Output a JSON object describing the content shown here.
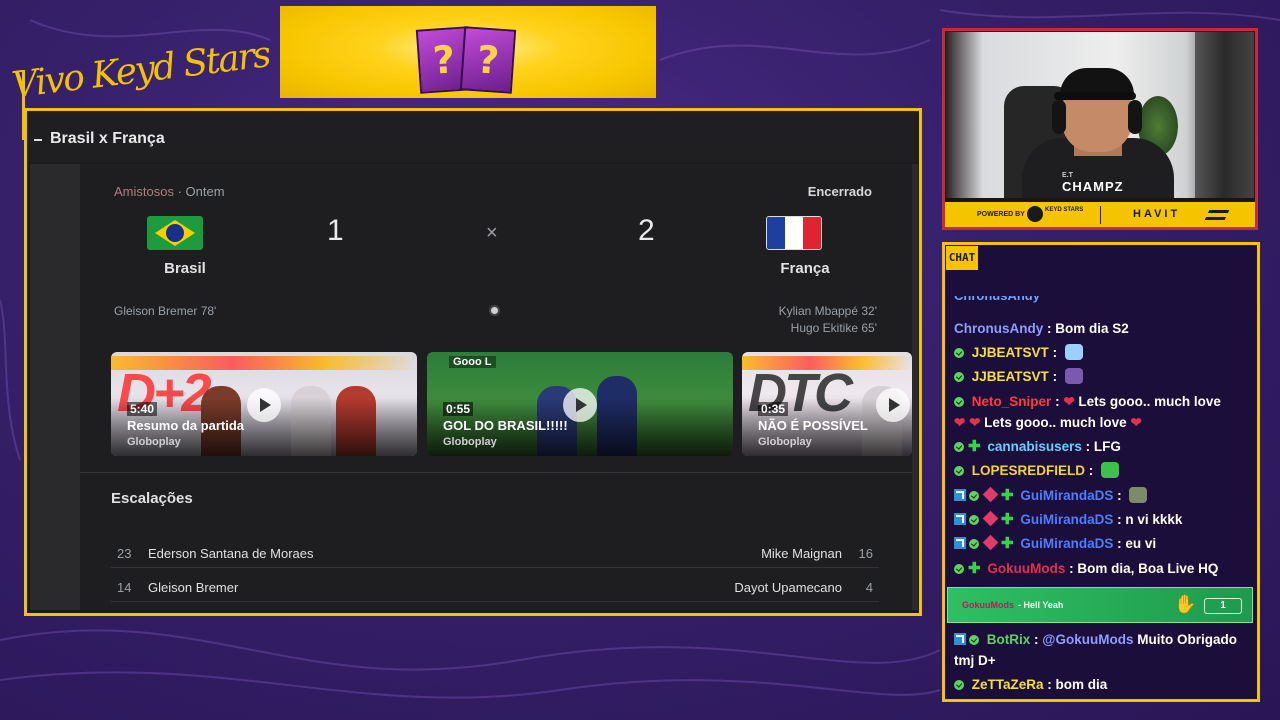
{
  "brand": {
    "text": "Vivo Keyd Stars"
  },
  "banner": {
    "box1": "?",
    "box2": "?"
  },
  "panel": {
    "title": "Brasil x França"
  },
  "match": {
    "competition": "Amistosos",
    "when": "· Ontem",
    "status": "Encerrado",
    "home": {
      "name": "Brasil",
      "score": "1",
      "scorers": [
        "Gleison Bremer 78'"
      ]
    },
    "away": {
      "name": "França",
      "score": "2",
      "scorers": [
        "Kylian Mbappé 32'",
        "Hugo Ekitike 65'"
      ]
    },
    "separator": "×"
  },
  "videos": [
    {
      "duration": "5:40",
      "title": "Resumo da partida",
      "source": "Globoplay"
    },
    {
      "duration": "0:55",
      "title": "GOL DO BRASIL!!!!!",
      "source": "Globoplay",
      "badge": "Gooo L"
    },
    {
      "duration": "0:35",
      "title": "NÃO É POSSÍVEL",
      "source": "Globoplay"
    }
  ],
  "lineups": {
    "title": "Escalações",
    "rows": [
      {
        "home_num": "23",
        "home_name": "Ederson Santana de Moraes",
        "away_name": "Mike Maignan",
        "away_num": "16"
      },
      {
        "home_num": "14",
        "home_name": "Gleison Bremer",
        "away_name": "Dayot Upamecano",
        "away_num": "4"
      }
    ]
  },
  "webcam": {
    "logo": "CHAMPZ",
    "logo_small": "E.T"
  },
  "sponsors": {
    "powered": "POWERED BY",
    "keyd": "KEYD STARS",
    "havit": "HAVIT"
  },
  "chat": {
    "label": "CHAT",
    "messages": [
      {
        "user": "ChronusAndy",
        "text": ": Bom dia S2",
        "color": "#8f9dff"
      },
      {
        "user": "JJBEATSVT",
        "text": ":",
        "color": "#f5e03a"
      },
      {
        "user": "JJBEATSVT",
        "text": ":",
        "color": "#f5e03a"
      },
      {
        "user": "Neto_Sniper",
        "text": ":",
        "text2": "Lets gooo.. much love",
        "color": "#ff3b3b"
      },
      {
        "text": "Lets gooo.. much love"
      },
      {
        "user": "cannabisusers",
        "text": ": LFG",
        "color": "#5fd3ff"
      },
      {
        "user": "LOPESREDFIELD",
        "text": ":",
        "color": "#f5d23a"
      },
      {
        "user": "GuiMirandaDS",
        "text": ":",
        "color": "#4f7dff"
      },
      {
        "user": "GuiMirandaDS",
        "text": ": n vi kkkk",
        "color": "#4f7dff"
      },
      {
        "user": "GuiMirandaDS",
        "text": ": eu vi",
        "color": "#4f7dff"
      },
      {
        "user": "GokuuMods",
        "text": ": Bom dia, Boa Live HQ",
        "color": "#e0304a"
      },
      {
        "user": "BotRix",
        "text": ":",
        "mention": "@GokuuMods",
        "text2": "Muito Obrigado",
        "color": "#5fd35f"
      },
      {
        "text": "tmj D+"
      },
      {
        "user": "ZeTTaZeRa",
        "text": ": bom dia",
        "color": "#f5e03a"
      }
    ],
    "hype": {
      "user": "GokuuMods",
      "message": "- Hell Yeah",
      "count": "1"
    }
  },
  "colors": {
    "accent": "#f5c400",
    "cam_border": "#c52a3e",
    "background": "#36206a"
  }
}
